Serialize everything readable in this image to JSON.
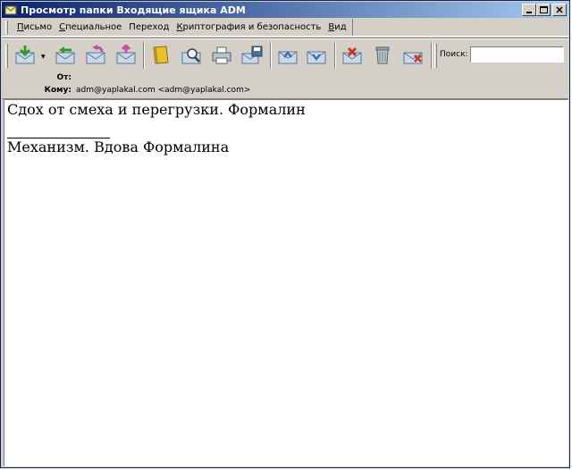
{
  "window": {
    "title": "Просмотр папки Входящие ящика ADM",
    "minimize": "_",
    "maximize": "□",
    "close": "✕"
  },
  "menu": {
    "items": [
      {
        "first": "П",
        "rest": "исьмо"
      },
      {
        "first": "С",
        "rest": "пециальное"
      },
      {
        "first": "П",
        "rest": "ереход"
      },
      {
        "first": "К",
        "rest": "риптография и безопасность"
      },
      {
        "first": "В",
        "rest": "ид"
      }
    ]
  },
  "toolbar": {
    "buttons": [
      "get-mail-icon",
      "reply-icon",
      "reply-all-icon",
      "forward-icon",
      "address-book-icon",
      "find-icon",
      "print-icon",
      "save-icon",
      "previous-icon",
      "next-icon",
      "mark-junk-icon",
      "trash-icon",
      "delete-icon"
    ],
    "search_label": "Поиск:",
    "search_value": ""
  },
  "headers": {
    "from_label": "От:",
    "from_value": "",
    "to_label": "Кому:",
    "to_value": "adm@yaplakal.com <adm@yaplakal.com>"
  },
  "message": {
    "line1": "Сдох от смеха и перегрузки. Формалин",
    "signature": "Механизм. Вдова Формалина"
  },
  "colors": {
    "titlebar_start": "#0a246a",
    "titlebar_end": "#a6caf0",
    "chrome": "#d4d0c8"
  }
}
